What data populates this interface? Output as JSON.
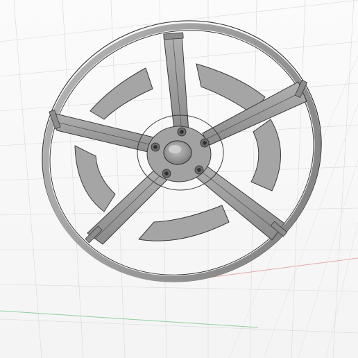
{
  "viewport": {
    "mode": "3d-model-view",
    "background_color": "#f6f6f6",
    "grid_color": "#d8d8d8",
    "x_axis_color": "#e9a9a9",
    "y_axis_color": "#8fcf9a",
    "model": {
      "name": "wheel-rim",
      "spoke_count": 5,
      "bolt_count": 5,
      "body_color": "#9a9a9a",
      "edge_color": "#3a3a3a",
      "hub_color": "#a8a8a8"
    }
  }
}
